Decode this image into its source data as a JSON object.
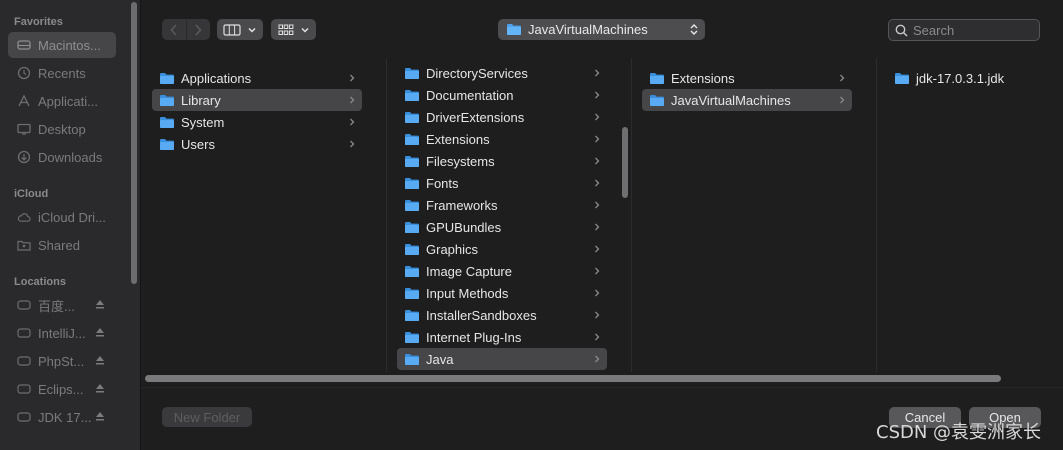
{
  "sidebar": {
    "sections": [
      {
        "title": "Favorites",
        "items": [
          {
            "label": "Macintos...",
            "icon": "hard-drive-icon",
            "selected": true
          },
          {
            "label": "Recents",
            "icon": "clock-icon"
          },
          {
            "label": "Applicati...",
            "icon": "applications-icon"
          },
          {
            "label": "Desktop",
            "icon": "desktop-icon"
          },
          {
            "label": "Downloads",
            "icon": "downloads-icon"
          }
        ]
      },
      {
        "title": "iCloud",
        "items": [
          {
            "label": "iCloud Dri...",
            "icon": "cloud-icon"
          },
          {
            "label": "Shared",
            "icon": "shared-folder-icon"
          }
        ]
      },
      {
        "title": "Locations",
        "items": [
          {
            "label": "百度...",
            "icon": "disk-icon",
            "eject": true
          },
          {
            "label": "IntelliJ...",
            "icon": "disk-icon",
            "eject": true
          },
          {
            "label": "PhpSt...",
            "icon": "disk-icon",
            "eject": true
          },
          {
            "label": "Eclips...",
            "icon": "disk-icon",
            "eject": true
          },
          {
            "label": "JDK 17...",
            "icon": "disk-icon",
            "eject": true
          }
        ]
      }
    ]
  },
  "toolbar": {
    "path_label": "JavaVirtualMachines",
    "search_placeholder": "Search"
  },
  "columns": [
    {
      "items": [
        {
          "label": "Applications",
          "chevron": true
        },
        {
          "label": "Library",
          "chevron": true,
          "selected": true
        },
        {
          "label": "System",
          "chevron": true
        },
        {
          "label": "Users",
          "chevron": true
        }
      ]
    },
    {
      "items": [
        {
          "label": "DirectoryServices",
          "chevron": true
        },
        {
          "label": "Documentation",
          "chevron": true
        },
        {
          "label": "DriverExtensions",
          "chevron": true
        },
        {
          "label": "Extensions",
          "chevron": true
        },
        {
          "label": "Filesystems",
          "chevron": true
        },
        {
          "label": "Fonts",
          "chevron": true
        },
        {
          "label": "Frameworks",
          "chevron": true
        },
        {
          "label": "GPUBundles",
          "chevron": true
        },
        {
          "label": "Graphics",
          "chevron": true
        },
        {
          "label": "Image Capture",
          "chevron": true
        },
        {
          "label": "Input Methods",
          "chevron": true
        },
        {
          "label": "InstallerSandboxes",
          "chevron": true
        },
        {
          "label": "Internet Plug-Ins",
          "chevron": true
        },
        {
          "label": "Java",
          "chevron": true,
          "selected": true
        }
      ]
    },
    {
      "items": [
        {
          "label": "Extensions",
          "chevron": true
        },
        {
          "label": "JavaVirtualMachines",
          "chevron": true,
          "selected": true
        }
      ]
    },
    {
      "items": [
        {
          "label": "jdk-17.0.3.1.jdk",
          "chevron": false
        }
      ]
    }
  ],
  "bottom": {
    "new_folder_label": "New Folder",
    "cancel_label": "Cancel",
    "open_label": "Open"
  },
  "watermark": "CSDN @袁雯洲家长"
}
